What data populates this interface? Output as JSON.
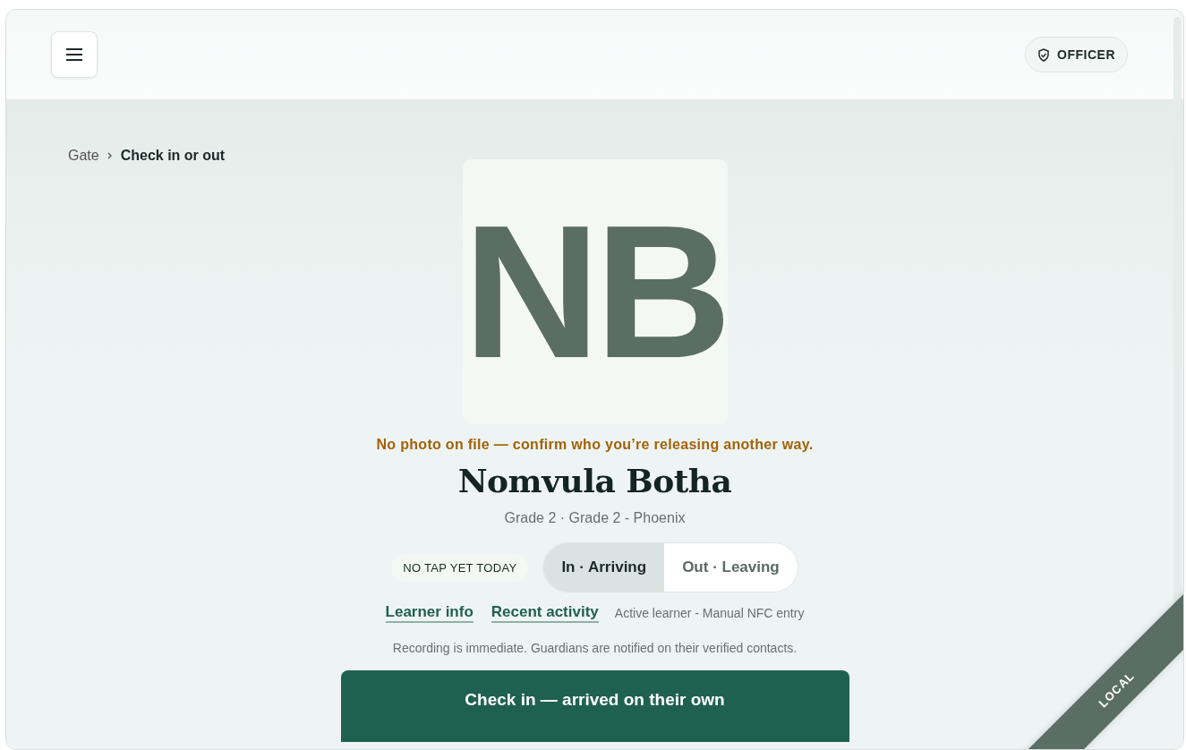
{
  "header": {
    "role_badge": "OFFICER"
  },
  "breadcrumb": [
    {
      "label": "Gate"
    },
    {
      "label": "Check in or out"
    }
  ],
  "learner": {
    "initials": "NB",
    "photo_warning": "No photo on file — confirm who you’re releasing another way.",
    "name": "Nomvula Botha",
    "subtitle": "Grade 2 · Grade 2 - Phoenix"
  },
  "status_chip": "NO TAP YET TODAY",
  "direction": [
    {
      "label": "In · Arriving",
      "selected": true
    },
    {
      "label": "Out · Leaving",
      "selected": false
    }
  ],
  "links": [
    "Learner info",
    "Recent activity"
  ],
  "meta": "Active learner - Manual NFC entry",
  "note": "Recording is immediate. Guardians are notified on their verified contacts.",
  "primary_button": "Check in — arrived on their own",
  "environment_ribbon": "LOCAL"
}
